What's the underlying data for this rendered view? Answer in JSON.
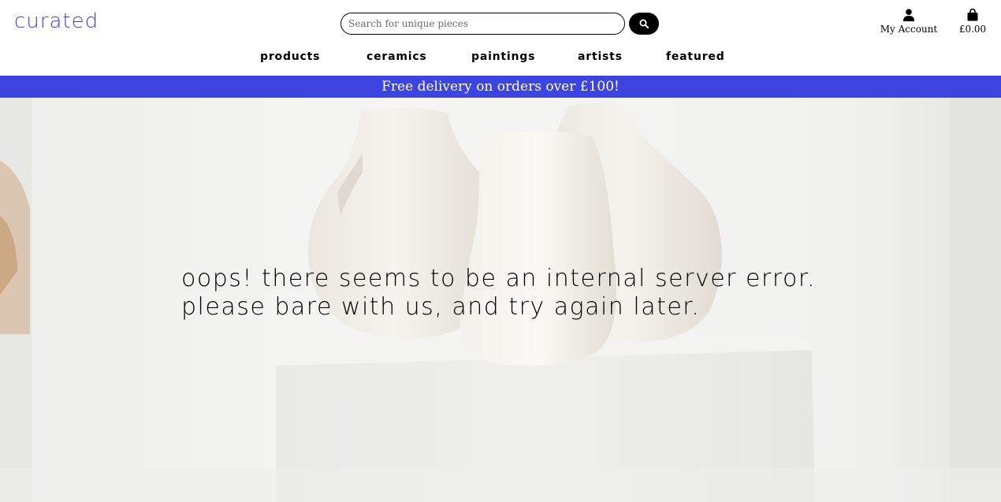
{
  "brand": {
    "logo_text": "curated",
    "accent_color": "#3d45e0"
  },
  "search": {
    "placeholder": "Search for unique pieces",
    "button_icon": "search-icon"
  },
  "account": {
    "label": "My Account",
    "icon": "user-icon"
  },
  "cart": {
    "total": "£0.00",
    "icon": "shopping-bag-icon"
  },
  "nav": {
    "items": [
      {
        "label": "Products"
      },
      {
        "label": "Ceramics"
      },
      {
        "label": "Paintings"
      },
      {
        "label": "Artists"
      },
      {
        "label": "Featured"
      }
    ]
  },
  "banner": {
    "text": "Free delivery on orders over £100!"
  },
  "hero": {
    "message": "Oops! There seems to be an internal server error. Please bare with us, and try again later."
  }
}
